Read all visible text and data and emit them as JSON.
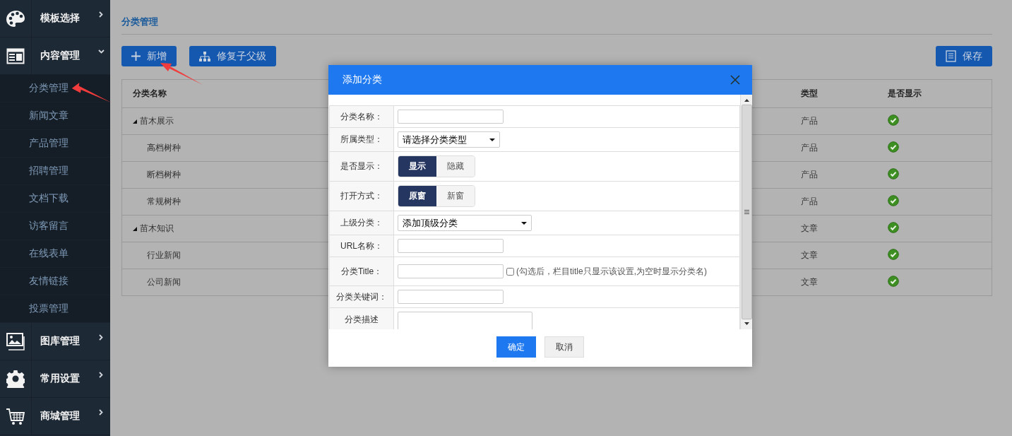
{
  "sidebar": {
    "items": [
      {
        "kind": "palette",
        "label": "模板选择",
        "expanded": false
      },
      {
        "kind": "layout",
        "label": "内容管理",
        "expanded": true,
        "children": [
          {
            "label": "分类管理"
          },
          {
            "label": "新闻文章"
          },
          {
            "label": "产品管理"
          },
          {
            "label": "招聘管理"
          },
          {
            "label": "文档下载"
          },
          {
            "label": "访客留言"
          },
          {
            "label": "在线表单"
          },
          {
            "label": "友情链接"
          },
          {
            "label": "投票管理"
          }
        ]
      },
      {
        "kind": "gallery",
        "label": "图库管理",
        "expanded": false
      },
      {
        "kind": "settings",
        "label": "常用设置",
        "expanded": false
      },
      {
        "kind": "cart",
        "label": "商城管理",
        "expanded": false
      }
    ]
  },
  "page": {
    "title": "分类管理",
    "toolbar": [
      {
        "kind": "add",
        "label": "新增"
      },
      {
        "kind": "tree",
        "label": "修复子父级"
      },
      {
        "kind": "save",
        "label": "保存"
      }
    ],
    "table": {
      "columns": [
        "分类名称",
        "类型",
        "是否显示"
      ],
      "rows": [
        {
          "name": "苗木展示",
          "type": "产品",
          "shown": true,
          "expanded": true,
          "children": [
            {
              "name": "高档树种",
              "type": "产品",
              "shown": true
            },
            {
              "name": "断档树种",
              "type": "产品",
              "shown": true
            },
            {
              "name": "常规树种",
              "type": "产品",
              "shown": true
            }
          ]
        },
        {
          "name": "苗木知识",
          "type": "文章",
          "shown": true,
          "expanded": true,
          "children": [
            {
              "name": "行业新闻",
              "type": "文章",
              "shown": true
            },
            {
              "name": "公司新闻",
              "type": "文章",
              "shown": true
            }
          ]
        }
      ]
    }
  },
  "dialog": {
    "title": "添加分类",
    "fields": [
      {
        "kind": "text",
        "label": "分类名称："
      },
      {
        "kind": "select",
        "label": "所属类型：",
        "value": "请选择分类类型"
      },
      {
        "kind": "toggle",
        "label": "是否显示：",
        "options": [
          {
            "label": "显示",
            "selected": true
          },
          {
            "label": "隐藏",
            "selected": false
          }
        ]
      },
      {
        "kind": "toggle",
        "label": "打开方式：",
        "options": [
          {
            "label": "原窗",
            "selected": true
          },
          {
            "label": "新窗",
            "selected": false
          }
        ]
      },
      {
        "kind": "select",
        "label": "上级分类：",
        "value": "添加顶级分类",
        "wide": true
      },
      {
        "kind": "text",
        "label": "URL名称："
      },
      {
        "kind": "text",
        "label": "分类Title：",
        "checkbox": {
          "checked": false
        },
        "hint": "(勾选后，栏目title只显示该设置,为空时显示分类名)"
      },
      {
        "kind": "text",
        "label": "分类关键词："
      },
      {
        "kind": "textarea",
        "label": "分类描述"
      }
    ],
    "buttons": [
      {
        "kind": "primary",
        "label": "确定"
      },
      {
        "kind": "default",
        "label": "取消"
      }
    ]
  }
}
